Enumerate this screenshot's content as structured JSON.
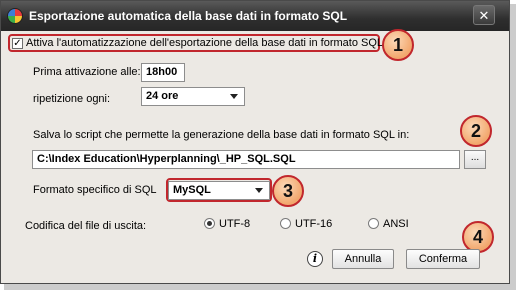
{
  "window": {
    "title": "Esportazione automatica della base dati in formato SQL",
    "close_glyph": "✕"
  },
  "auto_export": {
    "label": "Attiva l'automatizzazione dell'esportazione della base dati in formato SQL",
    "checked": true,
    "check_glyph": "✓"
  },
  "first_activation": {
    "label": "Prima attivazione alle:",
    "value": "18h00"
  },
  "repeat": {
    "label": "ripetizione ogni:",
    "value": "24 ore"
  },
  "script_path": {
    "label": "Salva lo script che permette la generazione della base dati in formato SQL in:",
    "value": "C:\\Index Education\\Hyperplanning\\_HP_SQL.SQL",
    "browse_label": "..."
  },
  "sql_format": {
    "label": "Formato specifico di SQL",
    "value": "MySQL"
  },
  "encoding": {
    "label": "Codifica del file di uscita:",
    "options": [
      "UTF-8",
      "UTF-16",
      "ANSI"
    ],
    "selected": "UTF-8"
  },
  "buttons": {
    "cancel": "Annulla",
    "confirm": "Conferma",
    "info_glyph": "i"
  },
  "annotations": [
    "1",
    "2",
    "3",
    "4"
  ],
  "colors": {
    "annotation_border": "#c1272d",
    "annotation_fill": "#f2a76d",
    "titlebar": "#2e2e2e"
  }
}
